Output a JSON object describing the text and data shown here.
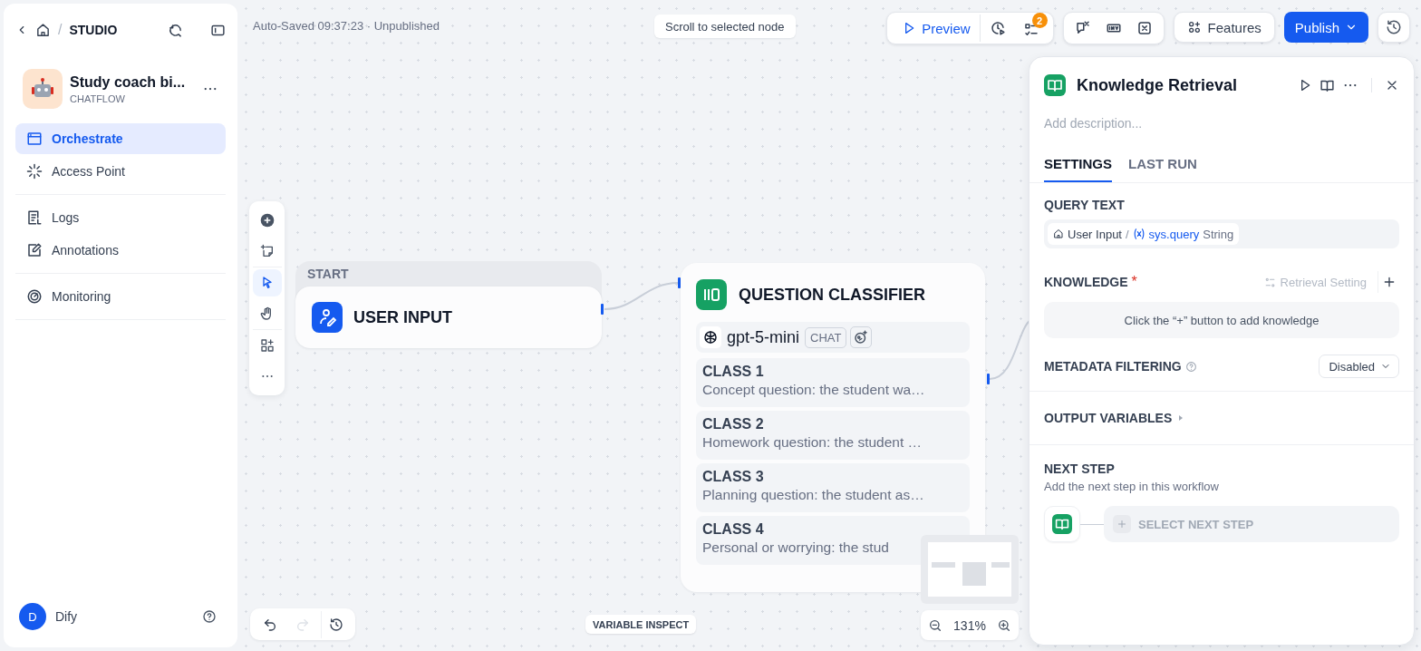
{
  "breadcrumb": {
    "separator": "/",
    "title": "STUDIO"
  },
  "app": {
    "name": "Study coach bi...",
    "type": "CHATFLOW"
  },
  "nav_groups": [
    {
      "items": [
        {
          "kind": "orchestrate",
          "label": "Orchestrate",
          "selected": true
        },
        {
          "kind": "access",
          "label": "Access Point",
          "selected": false
        }
      ]
    },
    {
      "items": [
        {
          "kind": "logs",
          "label": "Logs",
          "selected": false
        },
        {
          "kind": "annotations",
          "label": "Annotations",
          "selected": false
        }
      ]
    },
    {
      "items": [
        {
          "kind": "monitoring",
          "label": "Monitoring",
          "selected": false
        }
      ]
    }
  ],
  "user": {
    "initial": "D",
    "name": "Dify"
  },
  "autosave": "Auto-Saved 09:37:23 · Unpublished",
  "scroll_hint": "Scroll to selected node",
  "topbar": {
    "preview": "Preview",
    "badge": "2",
    "features": "Features",
    "publish": "Publish"
  },
  "tool_groups": [
    {
      "items": [
        {
          "kind": "add",
          "selected": false
        },
        {
          "kind": "note",
          "selected": false
        }
      ]
    },
    {
      "items": [
        {
          "kind": "pointer",
          "selected": true
        },
        {
          "kind": "hand",
          "selected": false
        }
      ]
    },
    {
      "items": [
        {
          "kind": "organize",
          "selected": false
        },
        {
          "kind": "more",
          "selected": false
        }
      ]
    }
  ],
  "start_node": {
    "header": "START",
    "title": "USER INPUT"
  },
  "classifier": {
    "title": "QUESTION CLASSIFIER",
    "model": "gpt-5-mini",
    "model_tag": "CHAT",
    "classes": [
      {
        "name": "CLASS 1",
        "text": "Concept question: the student wa…"
      },
      {
        "name": "CLASS 2",
        "text": "Homework question: the student …"
      },
      {
        "name": "CLASS 3",
        "text": "Planning question: the student as…"
      },
      {
        "name": "CLASS 4",
        "text": "Personal or worrying: the stud"
      }
    ]
  },
  "panel": {
    "title": "Knowledge Retrieval",
    "description_placeholder": "Add description...",
    "tabs": [
      {
        "label": "SETTINGS",
        "selected": true
      },
      {
        "label": "LAST RUN",
        "selected": false
      }
    ],
    "query_label": "QUERY TEXT",
    "query_node": "User Input",
    "query_sep": "/",
    "query_var": "sys.query",
    "query_type": "String",
    "knowledge_label": "KNOWLEDGE",
    "required_mark": "*",
    "retrieval_setting": {
      "label": "Retrieval Setting",
      "disabled": true
    },
    "knowledge_empty": "Click the “+” button to add knowledge",
    "metadata_label": "METADATA FILTERING",
    "metadata_value": "Disabled",
    "output": {
      "label": "OUTPUT VARIABLES",
      "expanded": false
    },
    "next_label": "NEXT STEP",
    "next_hint": "Add the next step in this workflow",
    "next_button": "SELECT NEXT STEP"
  },
  "history": [
    {
      "kind": "undo",
      "disabled": false
    },
    {
      "kind": "redo",
      "disabled": true
    },
    {
      "kind": "history",
      "disabled": false
    }
  ],
  "zoom": "131%",
  "variable_inspect": "VARIABLE INSPECT"
}
